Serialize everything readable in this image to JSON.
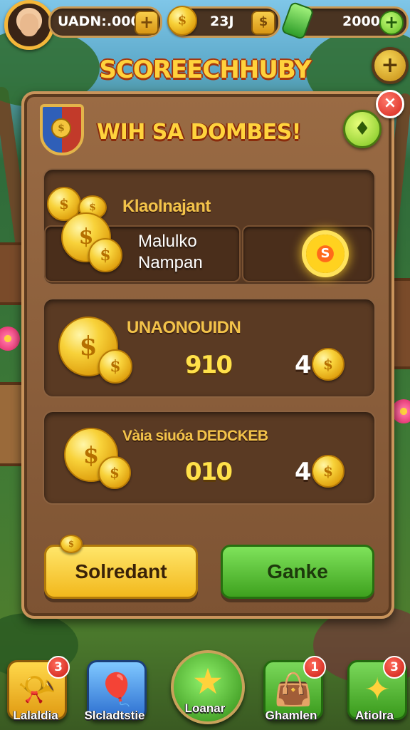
{
  "top_bar": {
    "resource1_value": "UADN:.000",
    "resource2_value": "23J",
    "resource3_value": "2000",
    "plus_label": "+"
  },
  "game_title": "SCOREECHHUBY",
  "panel": {
    "title": "WIH SA DOMBES!",
    "close_label": "×",
    "section1": {
      "label": "Klaolnajant",
      "slot_text_line1": "Malulko",
      "slot_text_line2": "Nampan",
      "sun_glyph": "S"
    },
    "section2": {
      "label": "UNAONOUIDN",
      "value": "910",
      "count": "4"
    },
    "section3": {
      "label": "Vàia siuóa DEDCKEB",
      "value": "010",
      "count": "4"
    },
    "button_left": "Solredant",
    "button_right": "Ganke"
  },
  "bottom_nav": {
    "items": [
      {
        "label": "Lalaldia",
        "badge": "3",
        "icon": "horn-icon",
        "color": "#f2b81c"
      },
      {
        "label": "Slcladtstie",
        "badge": "",
        "icon": "balloon-icon",
        "color": "#3f8fe0"
      },
      {
        "label": "Loanar",
        "badge": "",
        "icon": "star-icon",
        "color": "#3ea11e"
      },
      {
        "label": "Ghamlen",
        "badge": "1",
        "icon": "bag-icon",
        "color": "#4fae2a"
      },
      {
        "label": "Atiolra",
        "badge": "3",
        "icon": "gem-icon",
        "color": "#4fae2a"
      }
    ]
  },
  "colors": {
    "accent_gold": "#ffd23c",
    "panel_brown": "#7d5333",
    "close_red": "#d4231a",
    "button_yellow": "#f2b81c",
    "button_green": "#3ea11e"
  }
}
